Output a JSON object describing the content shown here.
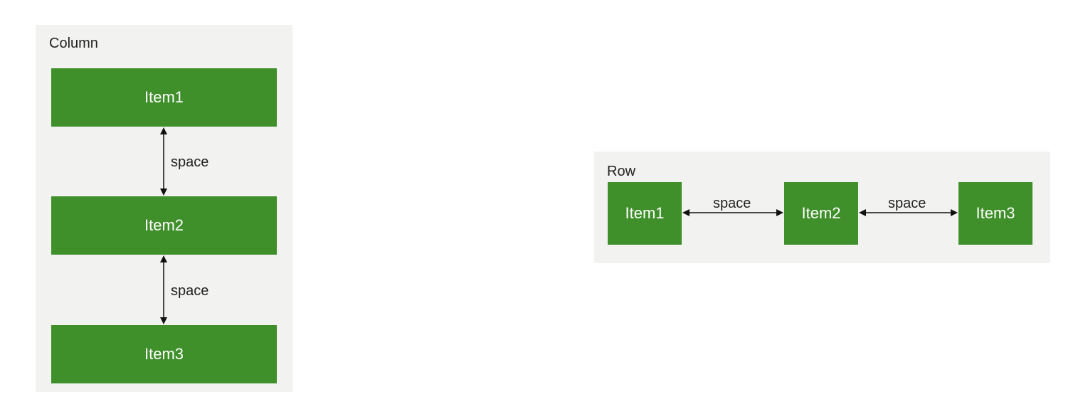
{
  "column": {
    "title": "Column",
    "items": [
      "Item1",
      "Item2",
      "Item3"
    ],
    "spaces": [
      "space",
      "space"
    ]
  },
  "row": {
    "title": "Row",
    "items": [
      "Item1",
      "Item2",
      "Item3"
    ],
    "spaces": [
      "space",
      "space"
    ]
  },
  "colors": {
    "item_fill": "#3f8f2a",
    "panel_fill": "#f2f2f0",
    "arrow": "#111111"
  }
}
